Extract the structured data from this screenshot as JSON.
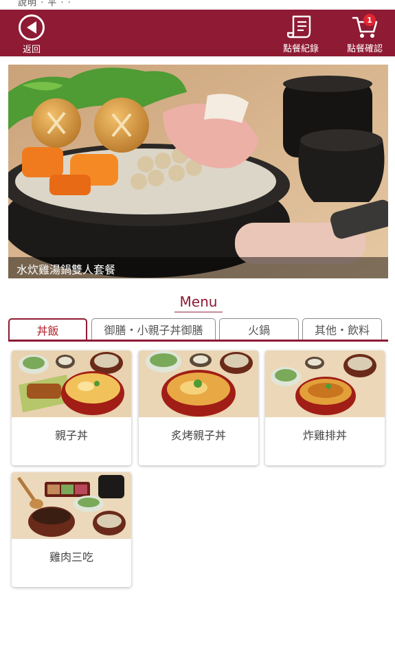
{
  "status_bar": {
    "partial_text": "說明 · 平 · ·"
  },
  "header": {
    "back_label": "返回",
    "history_label": "點餐紀錄",
    "cart_label": "點餐確認",
    "cart_count": "1",
    "color": "#8e1a33"
  },
  "hero": {
    "caption": "水炊雞湯鍋雙人套餐"
  },
  "menu": {
    "title": "Menu",
    "tabs": [
      {
        "label": "丼飯",
        "active": true
      },
      {
        "label": "御膳・小親子丼御膳",
        "active": false
      },
      {
        "label": "火鍋",
        "active": false
      },
      {
        "label": "其他・飲料",
        "active": false
      }
    ]
  },
  "items": [
    {
      "name": "親子丼",
      "icon": "oyakodon-photo"
    },
    {
      "name": "炙烤親子丼",
      "icon": "grilled-oyakodon-photo"
    },
    {
      "name": "炸雞排丼",
      "icon": "fried-chicken-cutlet-don-photo"
    },
    {
      "name": "雞肉三吃",
      "icon": "chicken-three-ways-photo"
    }
  ]
}
